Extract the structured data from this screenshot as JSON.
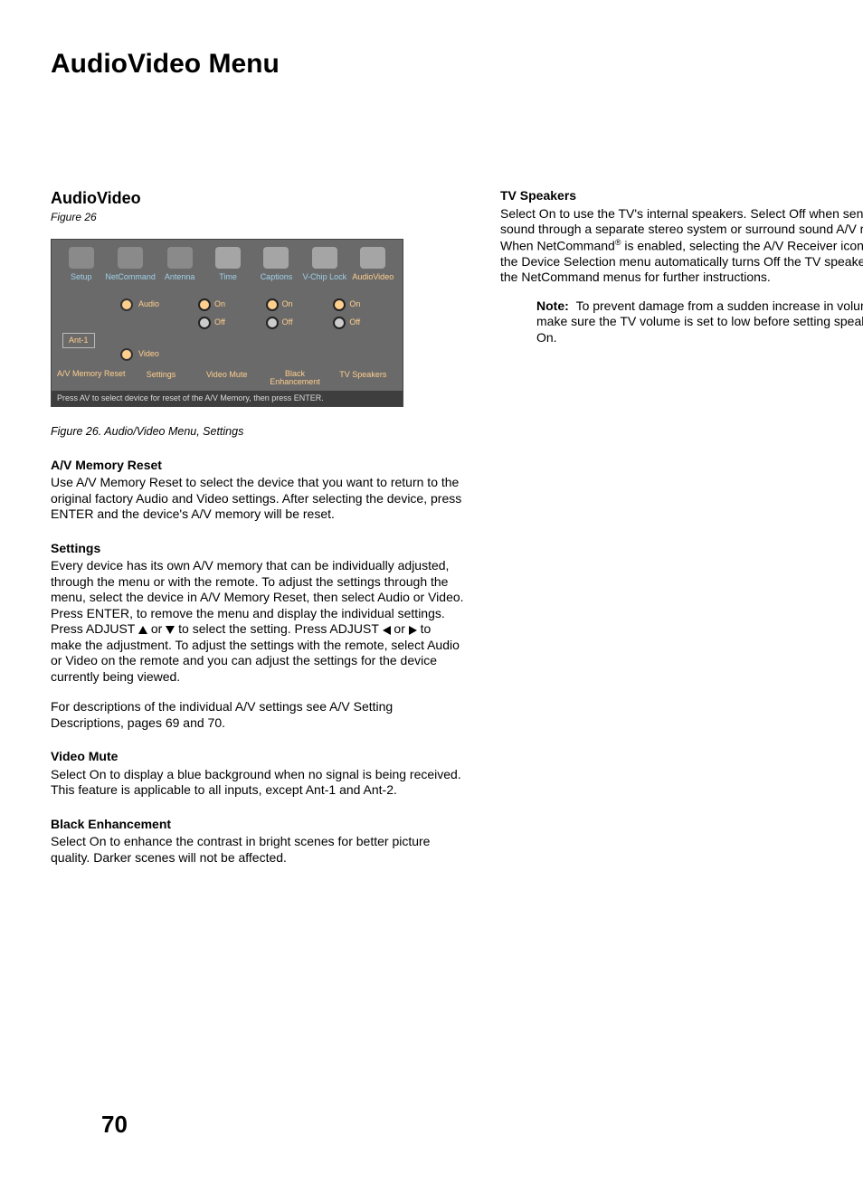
{
  "pageTitle": "AudioVideo Menu",
  "pageNumber": "70",
  "left": {
    "heading": "AudioVideo",
    "figRef": "Figure 26",
    "figure": {
      "tabs": [
        "Setup",
        "NetCommand",
        "Antenna",
        "Time",
        "Captions",
        "V-Chip Lock",
        "AudioVideo"
      ],
      "ant": "Ant-1",
      "settings": {
        "audio": "Audio",
        "video": "Video"
      },
      "opts": {
        "on": "On",
        "off": "Off"
      },
      "labels": {
        "mem": "A/V Memory Reset",
        "set": "Settings",
        "vm": "Video Mute",
        "be": "Black Enhancement",
        "tv": "TV Speakers"
      },
      "footer": "Press AV to select device for reset of the A/V Memory, then press ENTER."
    },
    "caption": "Figure 26. Audio/Video Menu, Settings",
    "sec1h": "A/V Memory Reset",
    "sec1p": "Use A/V Memory Reset to select the device that you want to return to the original factory Audio and Video settings.  After selecting the device, press ENTER and the device's A/V memory will be reset.",
    "sec2h": "Settings",
    "sec2p1a": "Every device has its own A/V memory that can be individually adjusted, through the menu or with the remote.  To adjust the settings through the menu, select the device in A/V Memory Reset, then select Audio or Video.  Press ENTER, to remove the menu and display the individual settings.  Press ADJUST ",
    "sec2p1b": " or ",
    "sec2p1c": " to select the setting.  Press ADJUST ",
    "sec2p1d": " or ",
    "sec2p1e": " to make the adjustment.  To adjust the settings with the remote, select Audio or Video on the remote and you can adjust the settings for the device currently being viewed.",
    "sec2p2": "For descriptions of the individual A/V settings see A/V Setting Descriptions, pages 69 and 70.",
    "sec3h": "Video Mute",
    "sec3p": "Select On to display a blue background when no signal is being received.  This feature is applicable to all inputs, except Ant-1 and Ant-2.",
    "sec4h": "Black Enhancement",
    "sec4p": "Select On to enhance the contrast in bright scenes for better picture quality.  Darker scenes will not be affected."
  },
  "right": {
    "sec1h": "TV Speakers",
    "sec1pa": "Select On to use the TV's internal speakers.  Select Off when sending the sound through a separate stereo system or surround sound A/V receiver.  When NetCommand",
    "sec1pb": " is enabled, selecting the A/V Receiver icon from the Device Selection menu automatically turns Off the TV speakers.  See the NetCommand menus for further instructions.",
    "noteLabel": "Note:",
    "noteBody": "To prevent damage from a sudden increase in volume, make sure the TV volume is set to low before setting speakers to On."
  }
}
